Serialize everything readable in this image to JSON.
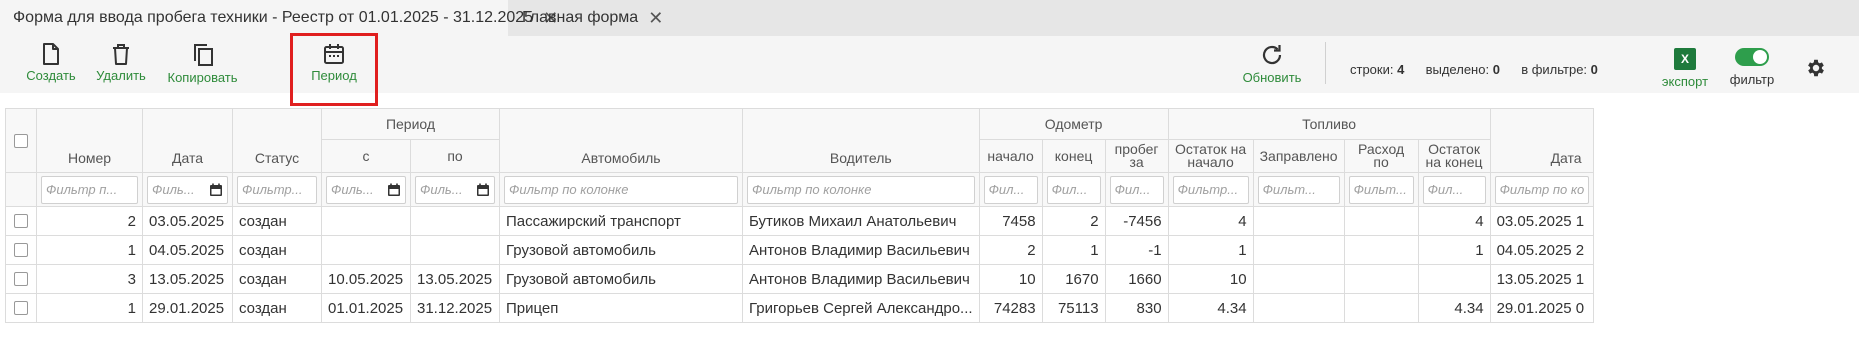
{
  "tabs": [
    {
      "label": "Форма для ввода пробега техники - Реестр от 01.01.2025 - 31.12.2025",
      "active": true
    },
    {
      "label": "Главная форма",
      "active": false
    }
  ],
  "toolbar": {
    "create": "Создать",
    "delete": "Удалить",
    "copy": "Копировать",
    "period": "Период",
    "refresh": "Обновить",
    "export": "экспорт",
    "filter": "фильтр",
    "excel_letter": "X"
  },
  "stats": {
    "rows_label": "строки:",
    "rows": "4",
    "selected_label": "выделено:",
    "selected": "0",
    "infilter_label": "в фильтре:",
    "infilter": "0"
  },
  "colors": {
    "accent": "#2e8b3a",
    "highlight": "#e01f1f",
    "excel": "#1e7a3c",
    "toggle": "#2e9e4c"
  },
  "grid": {
    "groups": {
      "period": "Период",
      "odometer": "Одометр",
      "fuel": "Топливо"
    },
    "headers": {
      "number": "Номер",
      "date": "Дата",
      "status": "Статус",
      "from": "с",
      "to": "по",
      "car": "Автомобиль",
      "driver": "Водитель",
      "odo_start": "начало",
      "odo_end": "конец",
      "odo_run": "пробег за",
      "fuel_start": "Остаток на начало",
      "fuel_filled": "Заправлено",
      "fuel_usage": "Расход по",
      "fuel_end": "Остаток на конец",
      "date2": "Дата"
    },
    "filters": {
      "short": "Фильтр п...",
      "date": "Филь...",
      "status": "Фильтр...",
      "col": "Фильтр по колонке",
      "odo": "Фил...",
      "fuel_start": "Фильтр...",
      "fuel_filled": "Фильт...",
      "fuel_usage": "Фильт...",
      "fuel_end": "Фил...",
      "date2": "Фильтр по ко"
    },
    "rows": [
      {
        "number": "2",
        "date": "03.05.2025",
        "status": "создан",
        "from": "",
        "to": "",
        "car": "Пассажирский транспорт",
        "driver": "Бутиков Михаил Анатольевич",
        "odo_start": "7458",
        "odo_end": "2",
        "odo_run": "-7456",
        "fuel_start": "4",
        "fuel_filled": "",
        "fuel_usage": "",
        "fuel_end": "4",
        "date2": "03.05.2025 1"
      },
      {
        "number": "1",
        "date": "04.05.2025",
        "status": "создан",
        "from": "",
        "to": "",
        "car": "Грузовой автомобиль",
        "driver": "Антонов Владимир Васильевич",
        "odo_start": "2",
        "odo_end": "1",
        "odo_run": "-1",
        "fuel_start": "1",
        "fuel_filled": "",
        "fuel_usage": "",
        "fuel_end": "1",
        "date2": "04.05.2025 2"
      },
      {
        "number": "3",
        "date": "13.05.2025",
        "status": "создан",
        "from": "10.05.2025",
        "to": "13.05.2025",
        "car": "Грузовой автомобиль",
        "driver": "Антонов Владимир Васильевич",
        "odo_start": "10",
        "odo_end": "1670",
        "odo_run": "1660",
        "fuel_start": "10",
        "fuel_filled": "",
        "fuel_usage": "",
        "fuel_end": "",
        "date2": "13.05.2025 1"
      },
      {
        "number": "1",
        "date": "29.01.2025",
        "status": "создан",
        "from": "01.01.2025",
        "to": "31.12.2025",
        "car": "Прицеп",
        "driver": "Григорьев Сергей Александро...",
        "odo_start": "74283",
        "odo_end": "75113",
        "odo_run": "830",
        "fuel_start": "4.34",
        "fuel_filled": "",
        "fuel_usage": "",
        "fuel_end": "4.34",
        "date2": "29.01.2025 0"
      }
    ]
  }
}
